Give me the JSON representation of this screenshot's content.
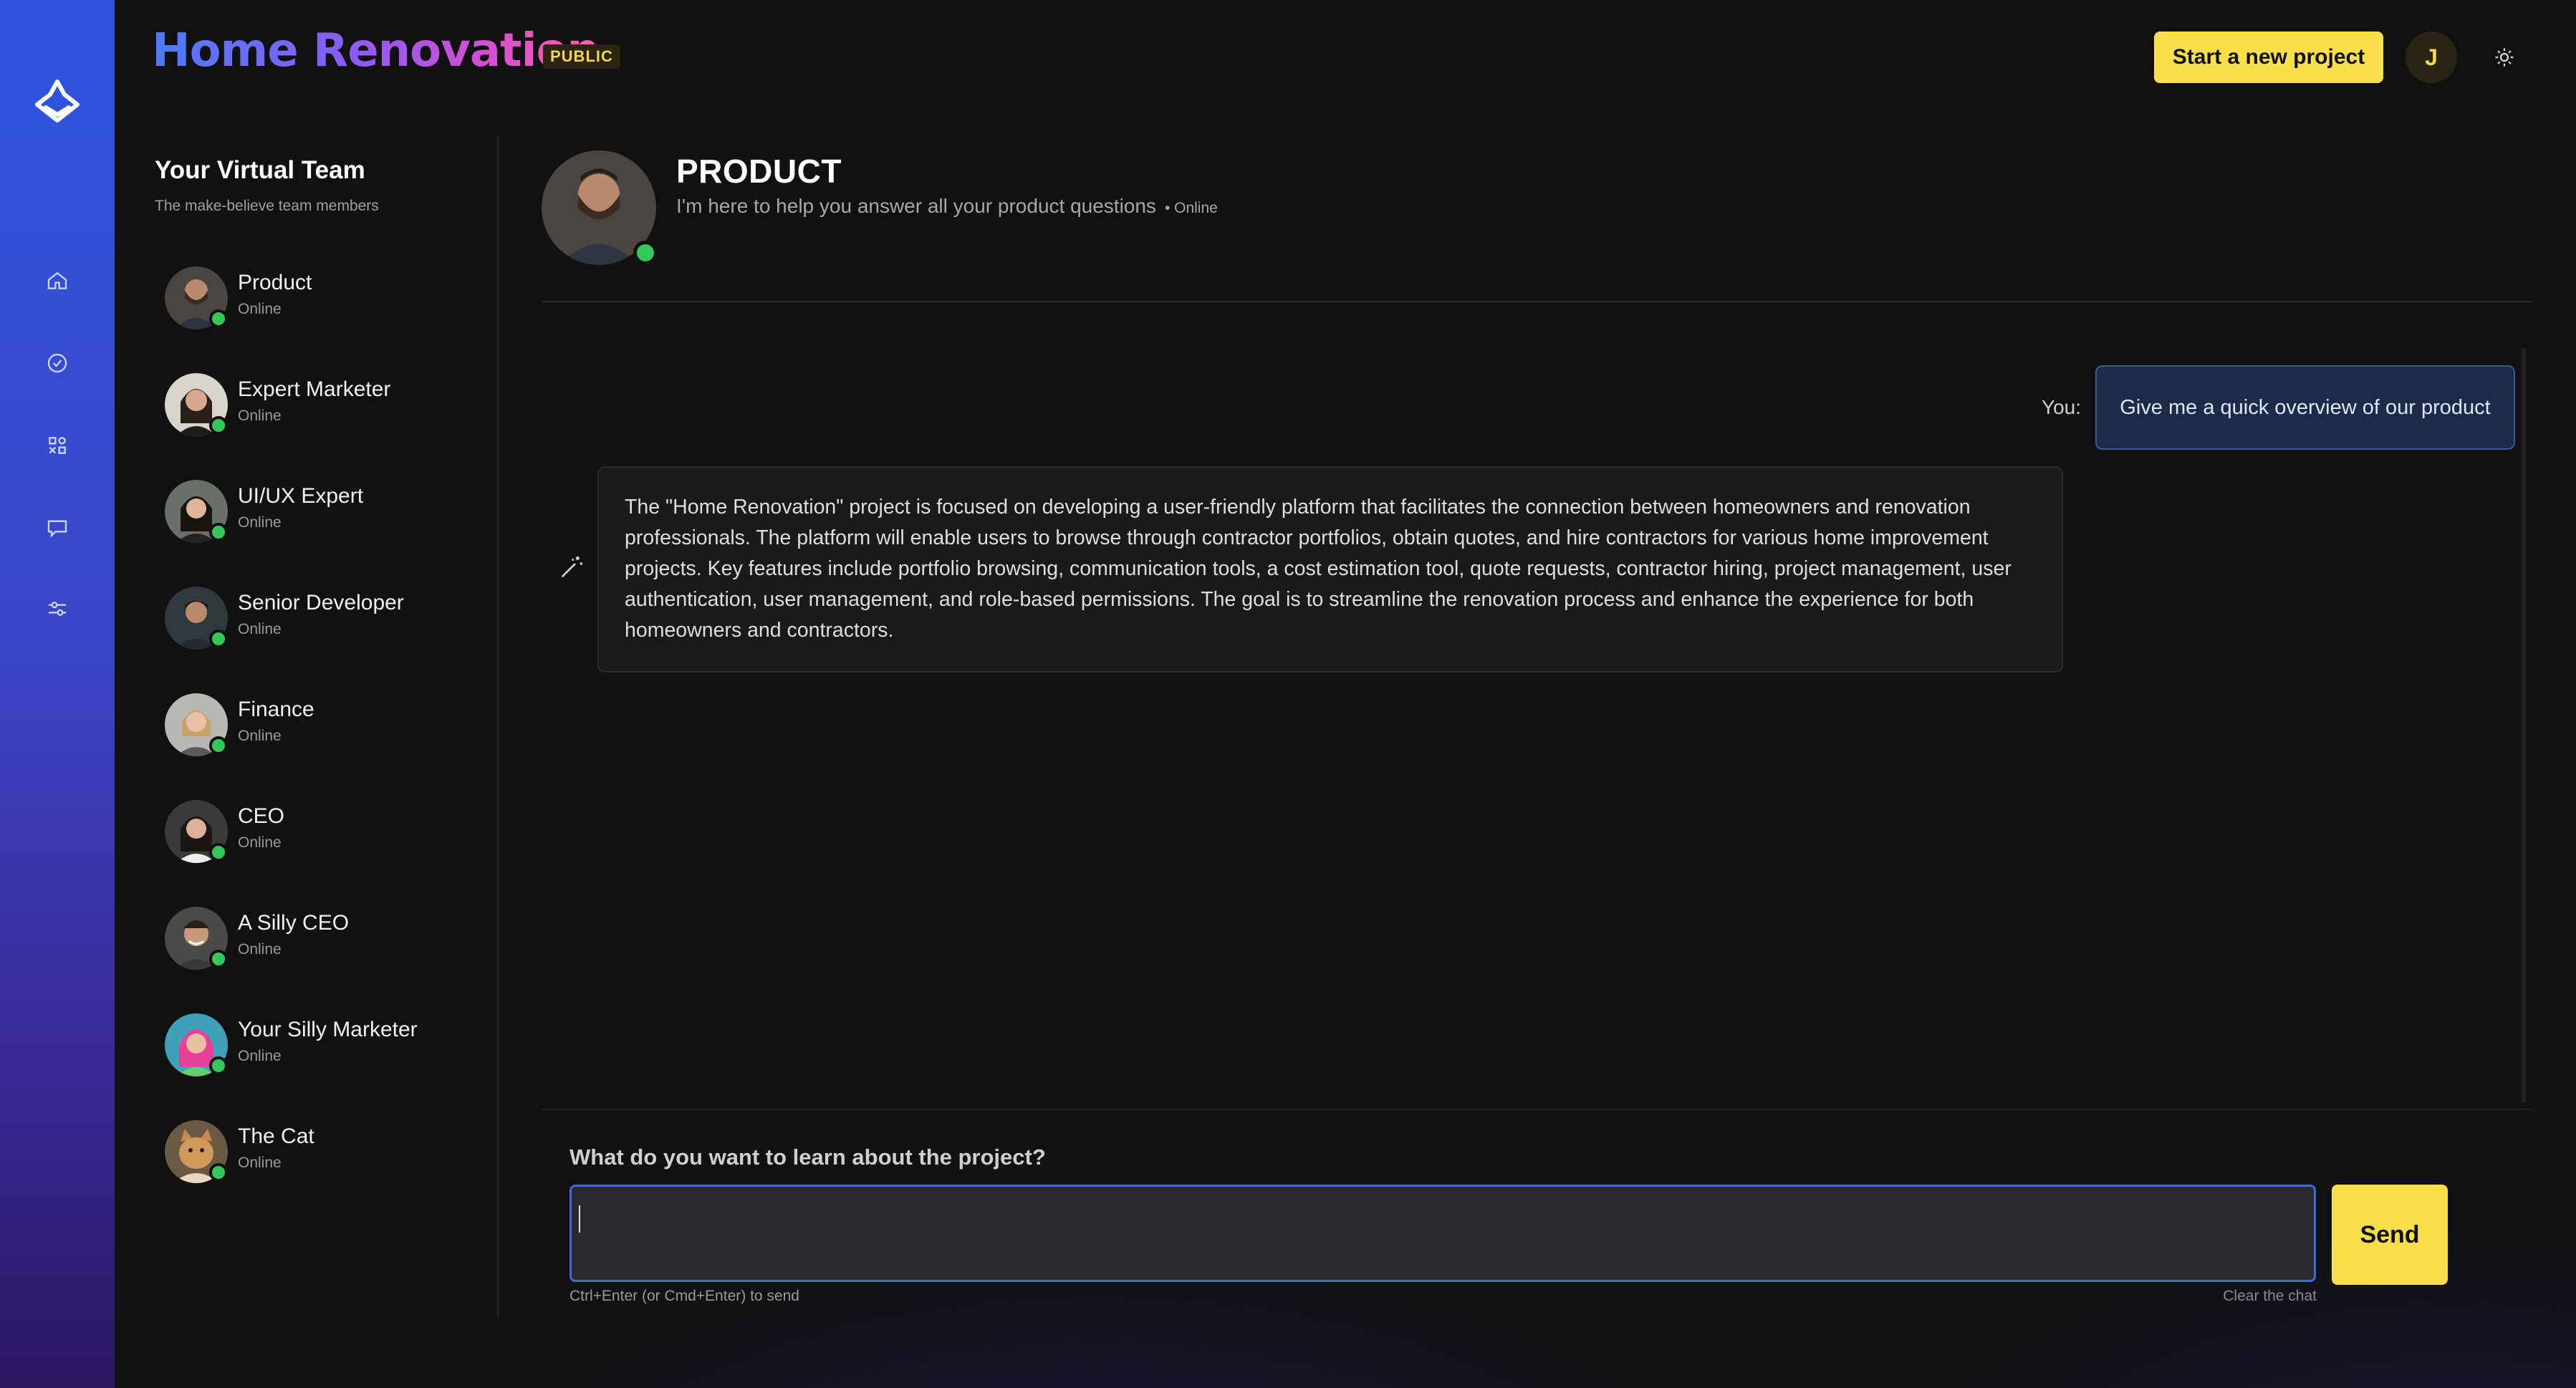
{
  "header": {
    "app_title": "Home Renovation",
    "visibility_badge": "PUBLIC",
    "new_project_label": "Start a new project",
    "user_initial": "J"
  },
  "nav": {
    "icons": [
      "home-icon",
      "check-circle-icon",
      "apps-icon",
      "chat-icon",
      "sliders-icon"
    ]
  },
  "team": {
    "title": "Your Virtual Team",
    "subtitle": "The make-believe team members",
    "members": [
      {
        "name": "Product",
        "status": "Online"
      },
      {
        "name": "Expert Marketer",
        "status": "Online"
      },
      {
        "name": "UI/UX Expert",
        "status": "Online"
      },
      {
        "name": "Senior Developer",
        "status": "Online"
      },
      {
        "name": "Finance",
        "status": "Online"
      },
      {
        "name": "CEO",
        "status": "Online"
      },
      {
        "name": "A Silly CEO",
        "status": "Online"
      },
      {
        "name": "Your Silly Marketer",
        "status": "Online"
      },
      {
        "name": "The Cat",
        "status": "Online"
      }
    ]
  },
  "chat": {
    "agent_name": "PRODUCT",
    "agent_description": "I'm here to help you answer all your product questions",
    "agent_status": "• Online",
    "you_label": "You:",
    "user_message": "Give me a quick overview of our product",
    "bot_message": "The \"Home Renovation\" project is focused on developing a user-friendly platform that facilitates the connection between homeowners and renovation professionals. The platform will enable users to browse through contractor portfolios, obtain quotes, and hire contractors for various home improvement projects. Key features include portfolio browsing, communication tools, a cost estimation tool, quote requests, contractor hiring, project management, user authentication, user management, and role-based permissions. The goal is to streamline the renovation process and enhance the experience for both homeowners and contractors."
  },
  "composer": {
    "label": "What do you want to learn about the project?",
    "value": "",
    "send_label": "Send",
    "hint": "Ctrl+Enter (or Cmd+Enter) to send",
    "clear_label": "Clear the chat"
  },
  "colors": {
    "accent_yellow": "#f9e04a",
    "online_green": "#34c759",
    "rail_blue": "#2f55e0",
    "input_border": "#3d6ae0"
  }
}
